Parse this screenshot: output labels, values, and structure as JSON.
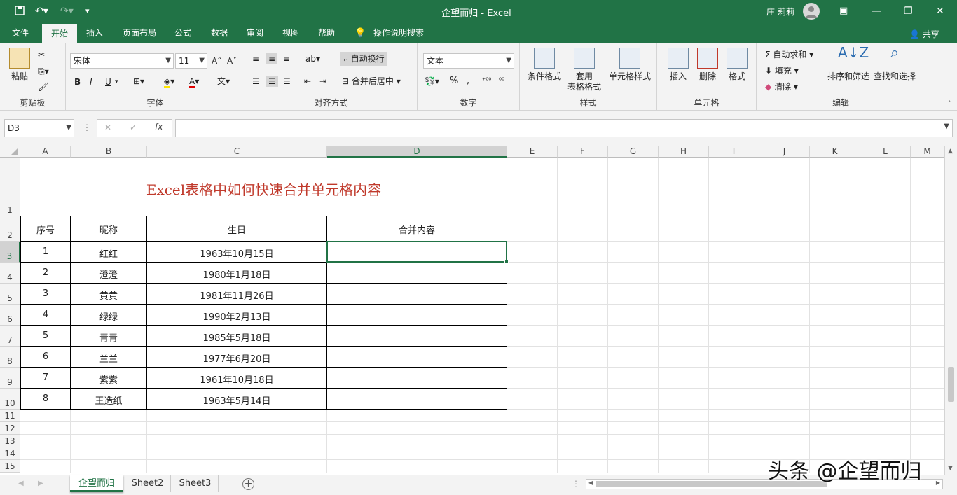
{
  "titlebar": {
    "title": "企望而归 - Excel",
    "user": "庄 莉莉"
  },
  "tabs": [
    "文件",
    "开始",
    "插入",
    "页面布局",
    "公式",
    "数据",
    "审阅",
    "视图",
    "帮助"
  ],
  "tell_me": "操作说明搜索",
  "share": "共享",
  "ribbon": {
    "clipboard": {
      "paste": "粘贴",
      "label": "剪贴板"
    },
    "font": {
      "name": "宋体",
      "size": "11",
      "bold": "B",
      "italic": "I",
      "underline": "U",
      "label": "字体"
    },
    "alignment": {
      "wrap": "自动换行",
      "merge": "合并后居中",
      "label": "对齐方式"
    },
    "number": {
      "format": "文本",
      "percent": "%",
      "comma": ",",
      "label": "数字"
    },
    "styles": {
      "cond": "条件格式",
      "table1": "套用",
      "table2": "表格格式",
      "cell": "单元格样式",
      "label": "样式"
    },
    "cells": {
      "insert": "插入",
      "delete": "删除",
      "format": "格式",
      "label": "单元格"
    },
    "editing": {
      "autosum": "自动求和",
      "fill": "填充",
      "clear": "清除",
      "sort": "排序和筛选",
      "find": "查找和选择",
      "label": "编辑"
    }
  },
  "formula_bar": {
    "name_box": "D3",
    "fx": "fx",
    "value": ""
  },
  "columns": [
    "A",
    "B",
    "C",
    "D",
    "E",
    "F",
    "G",
    "H",
    "I",
    "J",
    "K",
    "L",
    "M"
  ],
  "rows": [
    "1",
    "2",
    "3",
    "4",
    "5",
    "6",
    "7",
    "8",
    "9",
    "10",
    "11",
    "12",
    "13",
    "14",
    "15"
  ],
  "sheet": {
    "title": "Excel表格中如何快速合并单元格内容",
    "headers": [
      "序号",
      "昵称",
      "生日",
      "合并内容"
    ],
    "data": [
      [
        "1",
        "红红",
        "1963年10月15日",
        ""
      ],
      [
        "2",
        "澄澄",
        "1980年1月18日",
        ""
      ],
      [
        "3",
        "黄黄",
        "1981年11月26日",
        ""
      ],
      [
        "4",
        "绿绿",
        "1990年2月13日",
        ""
      ],
      [
        "5",
        "青青",
        "1985年5月18日",
        ""
      ],
      [
        "6",
        "兰兰",
        "1977年6月20日",
        ""
      ],
      [
        "7",
        "紫紫",
        "1961年10月18日",
        ""
      ],
      [
        "8",
        "王造纸",
        "1963年5月14日",
        ""
      ]
    ]
  },
  "sheet_tabs": [
    "企望而归",
    "Sheet2",
    "Sheet3"
  ],
  "watermark": "头条 @企望而归",
  "colors": {
    "excel_green": "#217346",
    "title_red": "#c0392b",
    "selection": "#217346"
  }
}
